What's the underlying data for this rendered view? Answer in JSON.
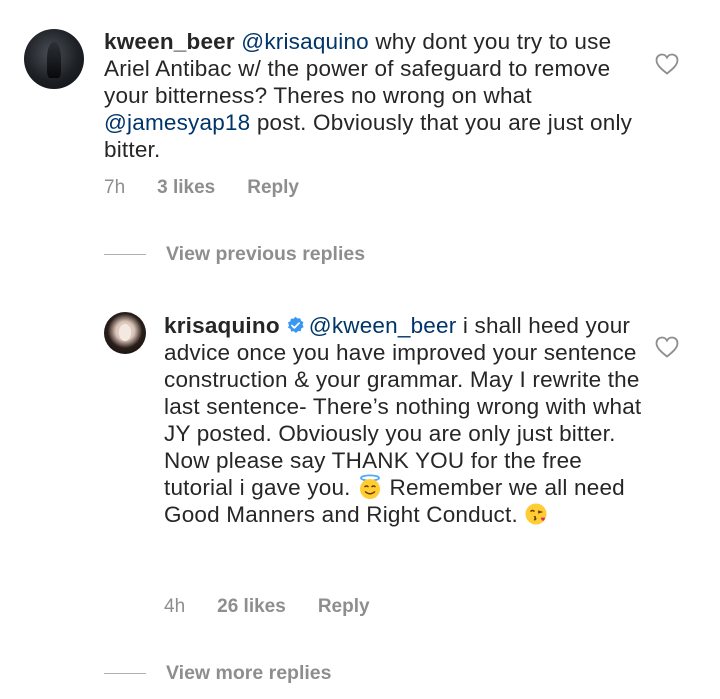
{
  "comment1": {
    "username": "kween_beer",
    "mention": "@krisaquino",
    "text_a": " why dont you try to use Ariel Antibac w/ the power of safeguard to remove your bitterness? Theres no wrong on what ",
    "mention2": "@jamesyap18",
    "text_b": " post. Obviously that  you are just only bitter.",
    "time": "7h",
    "likes": "3 likes",
    "reply": "Reply"
  },
  "view_previous": "View previous replies",
  "comment2": {
    "username": "krisaquino",
    "mention": "@kween_beer",
    "text_a": " i shall heed your advice once you have improved your sentence construction & your grammar. May I rewrite the last sentence- There’s nothing wrong with what JY posted. Obviously you are only just bitter. Now please say THANK YOU for the free tutorial i gave you. ",
    "text_b": " Remember we all need Good Manners and Right Conduct. ",
    "time": "4h",
    "likes": "26 likes",
    "reply": "Reply"
  },
  "view_more": "View more replies",
  "icons": {
    "heart": "heart-outline-icon",
    "verified": "verified-badge-icon",
    "emoji1": "smiling-face-with-halo",
    "emoji2": "face-blowing-a-kiss"
  },
  "colors": {
    "mention": "#003569",
    "meta": "#8e8e8e",
    "verified": "#3897f0"
  }
}
